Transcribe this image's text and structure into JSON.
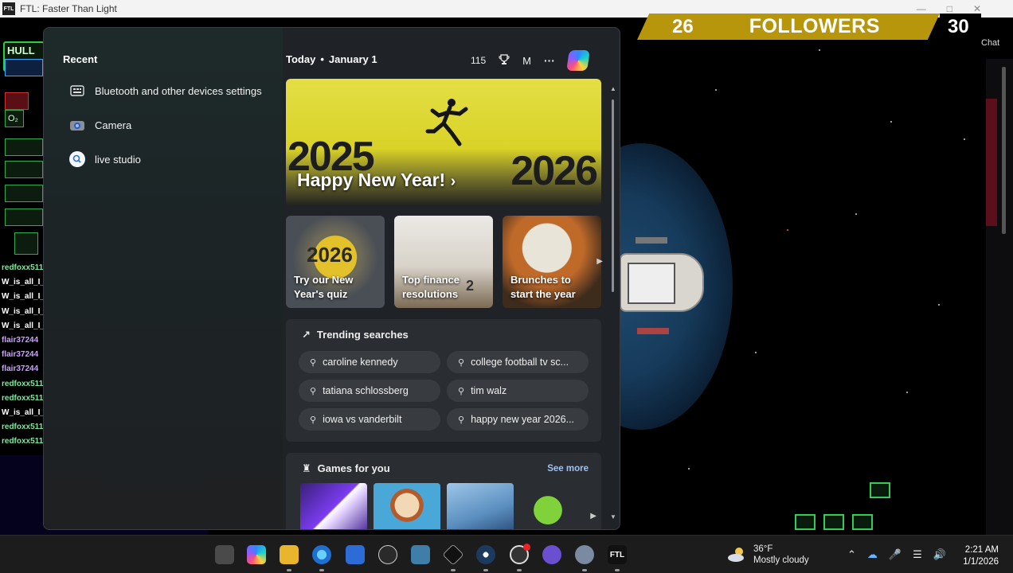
{
  "window": {
    "title": "FTL: Faster Than Light",
    "icon_label": "FTL"
  },
  "stream": {
    "followers_count": "26",
    "followers_label": "FOLLOWERS",
    "followers_goal": "30",
    "chat_tab": "Chat",
    "hull_label": "HULL",
    "oxygen_label": "O₂",
    "chat_names": [
      {
        "text": "redfoxx511",
        "color": "#7ee7a0"
      },
      {
        "text": "W_is_all_I_",
        "color": "#ffffff"
      },
      {
        "text": "W_is_all_I_",
        "color": "#ffffff"
      },
      {
        "text": "W_is_all_I_",
        "color": "#ffffff"
      },
      {
        "text": "W_is_all_I_",
        "color": "#ffffff"
      },
      {
        "text": "flair37244",
        "color": "#c9a2ff"
      },
      {
        "text": "flair37244",
        "color": "#c9a2ff"
      },
      {
        "text": "flair37244",
        "color": "#c9a2ff"
      },
      {
        "text": "redfoxx511",
        "color": "#7ee7a0"
      },
      {
        "text": "redfoxx511",
        "color": "#7ee7a0"
      },
      {
        "text": "W_is_all_I_",
        "color": "#ffffff"
      },
      {
        "text": "redfoxx511",
        "color": "#7ee7a0"
      },
      {
        "text": "redfoxx511",
        "color": "#7ee7a0"
      }
    ]
  },
  "flyout": {
    "recent_heading": "Recent",
    "recent_items": [
      {
        "label": "Bluetooth and other devices settings",
        "icon": "settings-icon"
      },
      {
        "label": "Camera",
        "icon": "camera-icon"
      },
      {
        "label": "live studio",
        "icon": "search-icon"
      }
    ],
    "today_label": "Today",
    "date_label": "January 1",
    "points": "115",
    "avatar_letter": "M",
    "more_label": "···",
    "hero": {
      "year_left": "2025",
      "year_right": "2026",
      "title": "Happy New Year!",
      "chevron": "›"
    },
    "cards": [
      {
        "caption": "Try our New Year's quiz",
        "badge": "2026"
      },
      {
        "caption": "Top finance resolutions",
        "badge": "2"
      },
      {
        "caption": "Brunches to start the year",
        "badge": ""
      }
    ],
    "trending_heading": "Trending searches",
    "trending": [
      "caroline kennedy",
      "college football tv sc...",
      "tatiana schlossberg",
      "tim walz",
      "iowa vs vanderbilt",
      "happy new year 2026..."
    ],
    "games_heading": "Games for you",
    "see_more": "See more"
  },
  "taskbar": {
    "weather_temp": "36°F",
    "weather_desc": "Mostly cloudy",
    "time": "2:21 AM",
    "date": "1/1/2026",
    "ftl_label": "FTL"
  },
  "colors": {
    "accent": "#b8960c",
    "flyout_bg": "#1f2226",
    "taskbar_bg": "#1c1c1c"
  }
}
